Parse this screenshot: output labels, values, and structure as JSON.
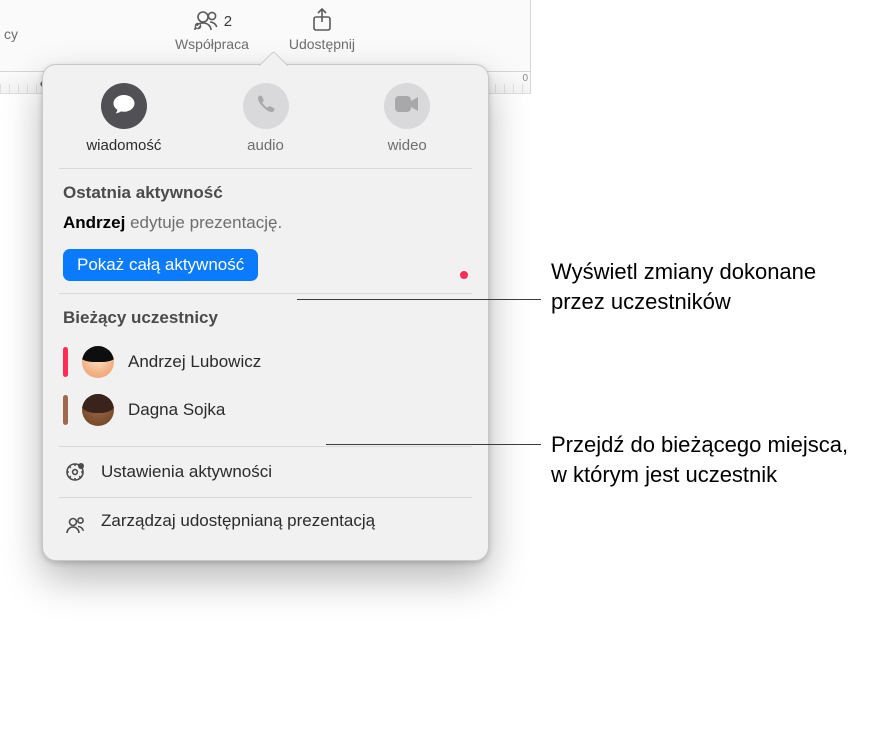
{
  "toolbar": {
    "collab_label": "Współpraca",
    "collab_badge": "2",
    "share_label": "Udostępnij",
    "truncated": "cy"
  },
  "ruler": {
    "end": "0"
  },
  "popover": {
    "actions": {
      "message": "wiadomość",
      "audio": "audio",
      "video": "wideo"
    },
    "recent_heading": "Ostatnia aktywność",
    "activity_user": "Andrzej",
    "activity_rest": " edytuje prezentację.",
    "show_all": "Pokaż całą aktywność",
    "participants_heading": "Bieżący uczestnicy",
    "participants": [
      {
        "name": "Andrzej Lubowicz",
        "color": "pink"
      },
      {
        "name": "Dagna Sojka",
        "color": "brown"
      }
    ],
    "menu": {
      "activity_settings": "Ustawienia aktywności",
      "manage_shared": "Zarządzaj udostępnianą prezentacją"
    }
  },
  "callouts": {
    "c1": "Wyświetl zmiany dokonane przez uczestników",
    "c2": "Przejdź do bieżącego miejsca, w którym jest uczestnik"
  }
}
